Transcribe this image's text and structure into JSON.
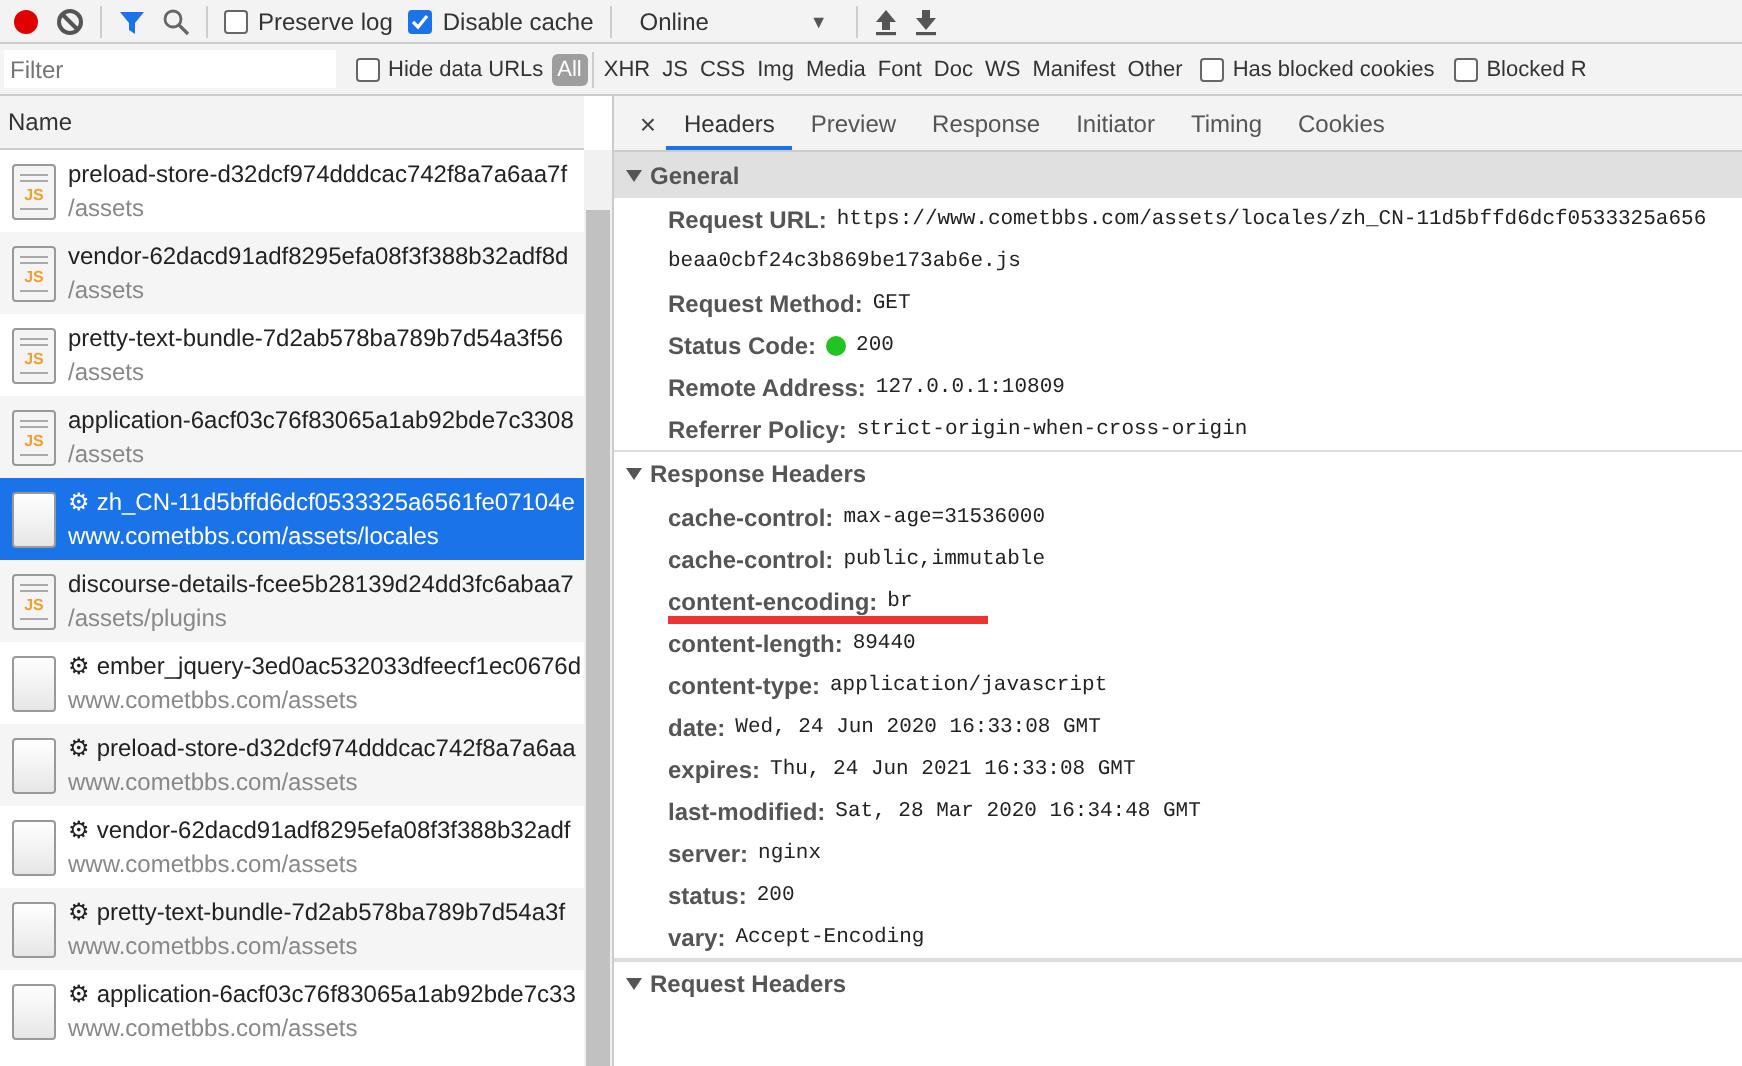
{
  "toolbar": {
    "recording": true,
    "filter_active": true,
    "checkboxes": [
      {
        "label": "Preserve log",
        "checked": false
      },
      {
        "label": "Disable cache",
        "checked": true
      }
    ],
    "throttle": {
      "value": "Online",
      "caret": "▼"
    }
  },
  "filter_bar": {
    "placeholder": "Filter",
    "hide_data_urls": {
      "label": "Hide data URLs",
      "checked": false
    },
    "types": [
      {
        "label": "All",
        "selected": true
      },
      {
        "label": "XHR",
        "selected": false
      },
      {
        "label": "JS",
        "selected": false
      },
      {
        "label": "CSS",
        "selected": false
      },
      {
        "label": "Img",
        "selected": false
      },
      {
        "label": "Media",
        "selected": false
      },
      {
        "label": "Font",
        "selected": false
      },
      {
        "label": "Doc",
        "selected": false
      },
      {
        "label": "WS",
        "selected": false
      },
      {
        "label": "Manifest",
        "selected": false
      },
      {
        "label": "Other",
        "selected": false
      }
    ],
    "extra_checkboxes": [
      {
        "label": "Has blocked cookies",
        "checked": false
      },
      {
        "label": "Blocked R",
        "checked": false
      }
    ]
  },
  "requests": {
    "column": "Name",
    "rows": [
      {
        "kind": "script",
        "icon_text": "JS",
        "name": "preload-store-d32dcf974dddcac742f8a7a6aa7f",
        "path": "/assets",
        "selected": false
      },
      {
        "kind": "script",
        "icon_text": "JS",
        "name": "vendor-62dacd91adf8295efa08f3f388b32adf8d",
        "path": "/assets",
        "selected": false
      },
      {
        "kind": "script",
        "icon_text": "JS",
        "name": "pretty-text-bundle-7d2ab578ba789b7d54a3f56",
        "path": "/assets",
        "selected": false
      },
      {
        "kind": "script",
        "icon_text": "JS",
        "name": "application-6acf03c76f83065a1ab92bde7c3308",
        "path": "/assets",
        "selected": false
      },
      {
        "kind": "blank",
        "name": "⚙ zh_CN-11d5bffd6dcf0533325a6561fe07104e",
        "path": "www.cometbbs.com/assets/locales",
        "selected": true
      },
      {
        "kind": "script",
        "icon_text": "JS",
        "name": "discourse-details-fcee5b28139d24dd3fc6abaa7",
        "path": "/assets/plugins",
        "selected": false
      },
      {
        "kind": "blank",
        "name": "⚙ ember_jquery-3ed0ac532033dfeecf1ec0676d",
        "path": "www.cometbbs.com/assets",
        "selected": false
      },
      {
        "kind": "blank",
        "name": "⚙ preload-store-d32dcf974dddcac742f8a7a6aa",
        "path": "www.cometbbs.com/assets",
        "selected": false
      },
      {
        "kind": "blank",
        "name": "⚙ vendor-62dacd91adf8295efa08f3f388b32adf",
        "path": "www.cometbbs.com/assets",
        "selected": false
      },
      {
        "kind": "blank",
        "name": "⚙ pretty-text-bundle-7d2ab578ba789b7d54a3f",
        "path": "www.cometbbs.com/assets",
        "selected": false
      },
      {
        "kind": "blank",
        "name": "⚙ application-6acf03c76f83065a1ab92bde7c33",
        "path": "www.cometbbs.com/assets",
        "selected": false
      }
    ]
  },
  "details": {
    "close": "×",
    "tabs": [
      {
        "label": "Headers",
        "selected": true
      },
      {
        "label": "Preview",
        "selected": false
      },
      {
        "label": "Response",
        "selected": false
      },
      {
        "label": "Initiator",
        "selected": false
      },
      {
        "label": "Timing",
        "selected": false
      },
      {
        "label": "Cookies",
        "selected": false
      }
    ],
    "sections": [
      {
        "title": "General",
        "expanded": true,
        "highlighted": true,
        "items": [
          {
            "name": "Request URL:",
            "value": "https://www.cometbbs.com/assets/locales/zh_CN-11d5bffd6dcf0533325a656",
            "continuation": "beaa0cbf24c3b869be173ab6e.js"
          },
          {
            "name": "Request Method:",
            "value": "GET"
          },
          {
            "name": "Status Code:",
            "value": "200",
            "kind": "status"
          },
          {
            "name": "Remote Address:",
            "value": "127.0.0.1:10809"
          },
          {
            "name": "Referrer Policy:",
            "value": "strict-origin-when-cross-origin"
          }
        ]
      },
      {
        "title": "Response Headers",
        "expanded": true,
        "highlighted": false,
        "items": [
          {
            "name": "cache-control:",
            "value": "max-age=31536000"
          },
          {
            "name": "cache-control:",
            "value": "public,immutable"
          },
          {
            "name": "content-encoding:",
            "value": "br",
            "underlined": true
          },
          {
            "name": "content-length:",
            "value": "89440"
          },
          {
            "name": "content-type:",
            "value": "application/javascript"
          },
          {
            "name": "date:",
            "value": "Wed, 24 Jun 2020 16:33:08 GMT"
          },
          {
            "name": "expires:",
            "value": "Thu, 24 Jun 2021 16:33:08 GMT"
          },
          {
            "name": "last-modified:",
            "value": "Sat, 28 Mar 2020 16:34:48 GMT"
          },
          {
            "name": "server:",
            "value": "nginx"
          },
          {
            "name": "status:",
            "value": "200"
          },
          {
            "name": "vary:",
            "value": "Accept-Encoding"
          }
        ]
      },
      {
        "title": "Request Headers",
        "expanded": true,
        "highlighted": false
      }
    ]
  }
}
